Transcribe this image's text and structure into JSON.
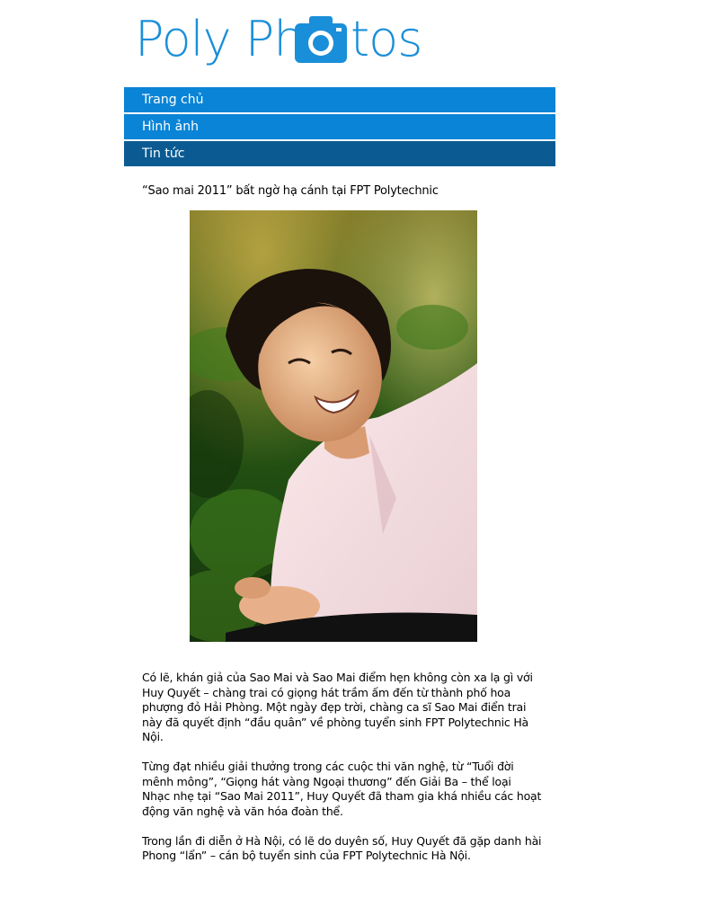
{
  "logo": {
    "text_part1": "Poly Ph",
    "text_part2": "tos",
    "camera_icon": "camera-icon",
    "brand_color": "#1a8fd9"
  },
  "nav": {
    "items": [
      {
        "label": "Trang chủ",
        "active": false
      },
      {
        "label": "Hình ảnh",
        "active": false
      },
      {
        "label": "Tin tức",
        "active": true
      }
    ],
    "colors": {
      "default": "#0a84d6",
      "active": "#0b5b92"
    }
  },
  "article": {
    "title": "“Sao mai 2011” bất ngờ hạ cánh tại FPT Polytechnic",
    "paragraphs": [
      "Có lẽ, khán giả của Sao Mai và Sao Mai điểm hẹn không còn xa lạ gì với Huy Quyết – chàng trai có giọng hát trầm ấm đến từ thành phố hoa phượng đỏ Hải Phòng.  Một ngày đẹp trời, chàng ca sĩ Sao Mai điển trai này đã quyết định “đầu quân” về phòng tuyển sinh FPT Polytechnic Hà Nội.",
      "Từng đạt nhiều giải thưởng trong các cuộc thi văn nghệ, từ “Tuổi đời mênh mông”, “Giọng hát vàng Ngoại thương” đến Giải Ba – thể loại Nhạc nhẹ  tại “Sao Mai 2011”, Huy Quyết đã tham gia khá nhiều các hoạt động văn nghệ và văn hóa đoàn thể.",
      "Trong lần đi diễn ở Hà Nội, có lẽ do duyên số, Huy Quyết đã gặp danh hài Phong “lẩn” – cán bộ tuyển sinh của FPT Polytechnic Hà Nội."
    ]
  }
}
